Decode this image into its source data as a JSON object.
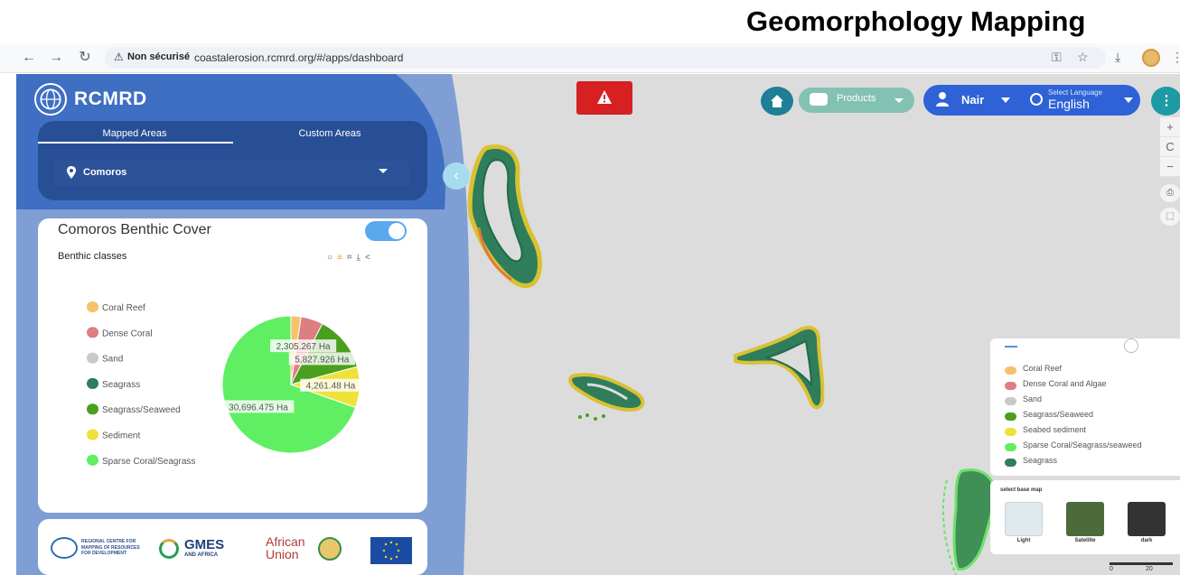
{
  "slide_title": "Geomorphology Mapping",
  "browser": {
    "back_icon": "arrow-left-icon",
    "forward_icon": "arrow-right-icon",
    "reload_icon": "reload-icon",
    "security_label": "Non sécurisé",
    "url": "coastalerosion.rcmrd.org/#/apps/dashboard"
  },
  "sidebar": {
    "brand": "RCMRD",
    "tabs": [
      "Mapped Areas",
      "Custom Areas"
    ],
    "active_tab": "Mapped Areas",
    "country": "Comoros"
  },
  "card": {
    "title": "Comoros Benthic Cover",
    "subtitle": "Benthic classes",
    "toggle_on": true
  },
  "chart_data": {
    "type": "pie",
    "categories": [
      "Coral Reef",
      "Dense Coral",
      "Sand",
      "Seagrass",
      "Seagrass/Seaweed",
      "Sediment",
      "Sparse Coral/Seagrass"
    ],
    "colors": [
      "#f5c26b",
      "#dd7e82",
      "#c9c9c9",
      "#2f7d5b",
      "#4a9f1c",
      "#eee23a",
      "#60ee63"
    ],
    "values": [
      1050,
      2305.267,
      0,
      0,
      5827.926,
      4261.48,
      30696.475
    ],
    "data_labels": [
      "",
      "2,305.267 Ha",
      "",
      "",
      "5,827.926 Ha",
      "4,261.48 Ha",
      "30,696.475 Ha"
    ],
    "legend_position": "left"
  },
  "partners": {
    "rcmrd_text": "REGIONAL CENTRE FOR MAPPING OF RESOURCES FOR DEVELOPMENT",
    "gmes_title": "GMES",
    "gmes_sub": "AND AFRICA",
    "au_text": "African Union"
  },
  "map_controls": {
    "products_label": "Products",
    "user_name": "Nair",
    "language_label": "Select Language",
    "language_value": "English",
    "zoom_in": "+",
    "reset": "C",
    "zoom_out": "−"
  },
  "map_legend": [
    {
      "label": "Coral Reef",
      "color": "#f5c26b"
    },
    {
      "label": "Dense Coral and Algae",
      "color": "#dd7e82"
    },
    {
      "label": "Sand",
      "color": "#c9c9c9"
    },
    {
      "label": "Seagrass/Seaweed",
      "color": "#4a9f1c"
    },
    {
      "label": "Seabed sediment",
      "color": "#eee23a"
    },
    {
      "label": "Sparse Coral/Seagrass/seaweed",
      "color": "#60ee63"
    },
    {
      "label": "Seagrass",
      "color": "#2f7d5b"
    }
  ],
  "basemap": {
    "title": "select base map",
    "options": [
      "Light",
      "Satellite",
      "dark"
    ]
  },
  "scale": {
    "labels": [
      "0",
      "20"
    ]
  }
}
